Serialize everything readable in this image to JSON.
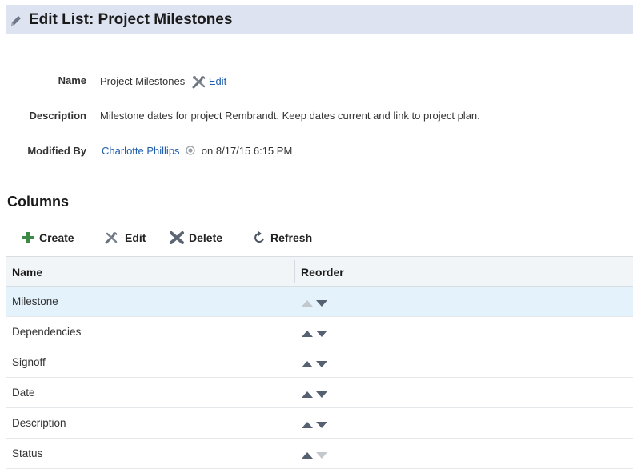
{
  "page": {
    "title": "Edit List: Project Milestones",
    "icon": "pencil-icon"
  },
  "details": {
    "name_label": "Name",
    "name_value": "Project Milestones",
    "edit_link": "Edit",
    "description_label": "Description",
    "description_value": "Milestone dates for project Rembrandt. Keep dates current and link to project plan.",
    "modified_by_label": "Modified By",
    "modified_by_user": "Charlotte Phillips",
    "modified_on": "on 8/17/15 6:15 PM"
  },
  "columns_section": {
    "title": "Columns",
    "toolbar": {
      "create": "Create",
      "edit": "Edit",
      "delete": "Delete",
      "refresh": "Refresh"
    },
    "headers": {
      "name": "Name",
      "reorder": "Reorder"
    },
    "rows": [
      {
        "name": "Milestone",
        "selected": true,
        "up_enabled": false,
        "down_enabled": true
      },
      {
        "name": "Dependencies",
        "selected": false,
        "up_enabled": true,
        "down_enabled": true
      },
      {
        "name": "Signoff",
        "selected": false,
        "up_enabled": true,
        "down_enabled": true
      },
      {
        "name": "Date",
        "selected": false,
        "up_enabled": true,
        "down_enabled": true
      },
      {
        "name": "Description",
        "selected": false,
        "up_enabled": true,
        "down_enabled": true
      },
      {
        "name": "Status",
        "selected": false,
        "up_enabled": true,
        "down_enabled": false
      }
    ]
  },
  "colors": {
    "header_bg": "#dde3f1",
    "link": "#1f5fae",
    "selected_row": "#e4f2fb",
    "create_icon": "#3c8a45",
    "delete_icon": "#5b6675"
  }
}
